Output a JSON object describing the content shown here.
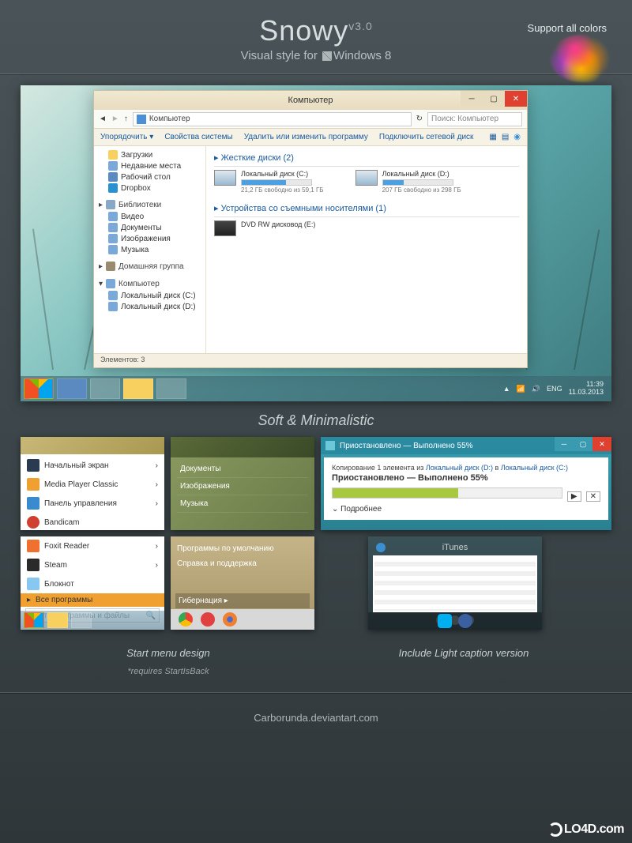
{
  "header": {
    "title": "Snowy",
    "version": "v3.0",
    "subtitle_pre": "Visual style for ",
    "subtitle_os": "Windows 8",
    "support": "Support all colors"
  },
  "explorer": {
    "title": "Компьютер",
    "addr_path": "Компьютер",
    "search_placeholder": "Поиск: Компьютер",
    "toolbar": {
      "organize": "Упорядочить",
      "props": "Свойства системы",
      "remove": "Удалить или изменить программу",
      "netdrive": "Подключить сетевой диск"
    },
    "sidebar": {
      "favorites": [
        {
          "label": "Загрузки"
        },
        {
          "label": "Недавние места"
        },
        {
          "label": "Рабочий стол"
        },
        {
          "label": "Dropbox"
        }
      ],
      "libraries_head": "Библиотеки",
      "libraries": [
        {
          "label": "Видео"
        },
        {
          "label": "Документы"
        },
        {
          "label": "Изображения"
        },
        {
          "label": "Музыка"
        }
      ],
      "homegroup": "Домашняя группа",
      "computer": "Компьютер",
      "drives": [
        {
          "label": "Локальный диск (C:)"
        },
        {
          "label": "Локальный диск (D:)"
        }
      ]
    },
    "sections": {
      "hdd_head": "Жесткие диски (2)",
      "removable_head": "Устройства со съемными носителями (1)"
    },
    "drives": {
      "c": {
        "name": "Локальный диск (C:)",
        "stat": "21,2 ГБ свободно из 59,1 ГБ",
        "pct": 64
      },
      "d": {
        "name": "Локальный диск (D:)",
        "stat": "207 ГБ свободно из 298 ГБ",
        "pct": 30
      },
      "dvd": {
        "name": "DVD RW дисковод (E:)"
      }
    },
    "status": "Элементов: 3"
  },
  "taskbar": {
    "lang": "ENG",
    "time": "11:39",
    "date": "11.03.2013"
  },
  "captions": {
    "soft": "Soft & Minimalistic",
    "start": "Start menu design",
    "start_req": "*requires StartIsBack",
    "light": "Include Light caption version"
  },
  "start_menu_a": {
    "items": [
      {
        "label": "Начальный экран"
      },
      {
        "label": "Media Player Classic"
      },
      {
        "label": "Панель управления"
      },
      {
        "label": "Bandicam"
      }
    ]
  },
  "start_menu_b": {
    "items": [
      {
        "label": "Foxit Reader"
      },
      {
        "label": "Steam"
      },
      {
        "label": "Блокнот"
      }
    ],
    "all": "Все программы",
    "search": "Найти программы и файлы"
  },
  "dark_menu": {
    "items": [
      "Документы",
      "Изображения",
      "Музыка"
    ]
  },
  "tan_menu": {
    "items": [
      "Программы по умолчанию",
      "Справка и поддержка"
    ],
    "hibernate": "Гибернация"
  },
  "copy": {
    "title": "Приостановлено — Выполнено 55%",
    "sub_pre": "Копирование 1 элемента из ",
    "sub_a": "Локальный диск (D:)",
    "sub_mid": " в ",
    "sub_b": "Локальный диск (C:)",
    "status": "Приостановлено — Выполнено 55%",
    "more": "Подробнее"
  },
  "itunes": {
    "title": "iTunes"
  },
  "footer": {
    "credit": "Carborunda.deviantart.com",
    "brand": "LO4D.com"
  }
}
